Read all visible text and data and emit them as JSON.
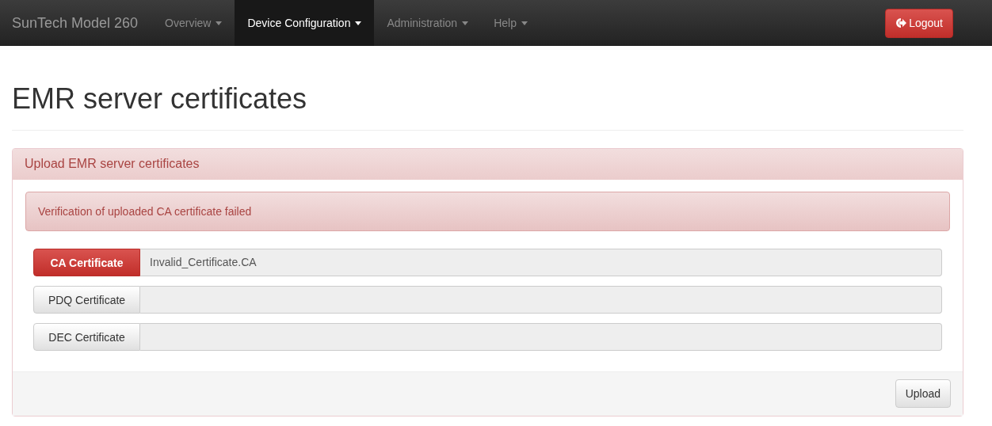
{
  "navbar": {
    "brand": "SunTech Model 260",
    "items": [
      {
        "label": "Overview",
        "selected": false
      },
      {
        "label": "Device Configuration",
        "selected": true
      },
      {
        "label": "Administration",
        "selected": false
      },
      {
        "label": "Help",
        "selected": false
      }
    ],
    "logout": "Logout"
  },
  "page_title": "EMR server certificates",
  "panel": {
    "heading": "Upload EMR server certificates",
    "alert": "Verification of uploaded CA certificate failed",
    "certificates": [
      {
        "label": "CA Certificate",
        "error": true,
        "value": "Invalid_Certificate.CA"
      },
      {
        "label": "PDQ Certificate",
        "error": false
      },
      {
        "label": "DEC Certificate",
        "error": false
      }
    ],
    "upload_button": "Upload"
  }
}
